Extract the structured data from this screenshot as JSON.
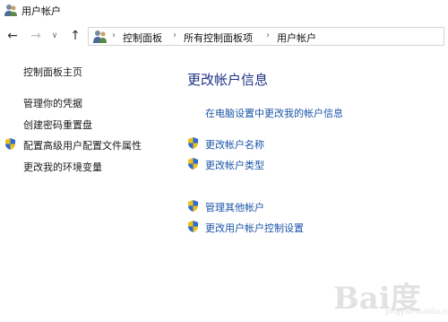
{
  "window": {
    "title": "用户帐户"
  },
  "breadcrumb": [
    "控制面板",
    "所有控制面板项",
    "用户帐户"
  ],
  "sidebar": {
    "items": [
      {
        "label": "控制面板主页",
        "shield": false
      },
      {
        "label": "管理你的凭据",
        "shield": false
      },
      {
        "label": "创建密码重置盘",
        "shield": false
      },
      {
        "label": "配置高级用户配置文件属性",
        "shield": true
      },
      {
        "label": "更改我的环境变量",
        "shield": false
      }
    ]
  },
  "main": {
    "heading": "更改帐户信息",
    "pc_settings_link": "在电脑设置中更改我的帐户信息",
    "links": [
      {
        "label": "更改帐户名称",
        "shield": true
      },
      {
        "label": "更改帐户类型",
        "shield": true
      },
      {
        "label": "管理其他帐户",
        "shield": true
      },
      {
        "label": "更改用户帐户控制设置",
        "shield": true
      }
    ]
  },
  "watermark": {
    "text": "Bai度",
    "sub": "jingyan.baidu.com"
  },
  "icons": {
    "back": "back-arrow-icon",
    "forward": "forward-arrow-icon",
    "recent": "chevron-down-icon",
    "up": "up-arrow-icon",
    "users": "users-icon",
    "shield": "uac-shield-icon"
  },
  "colors": {
    "heading": "#1e3287",
    "link": "#1a55a8"
  }
}
